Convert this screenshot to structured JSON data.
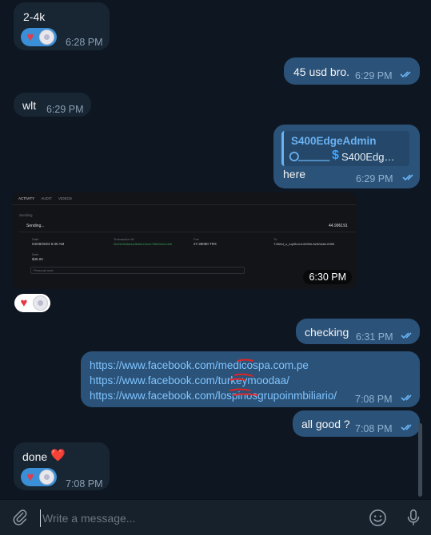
{
  "messages": {
    "m1": {
      "text": "2-4k",
      "time": "6:28 PM"
    },
    "m2": {
      "text": "45 usd bro.",
      "time": "6:29 PM"
    },
    "m3": {
      "text": "wlt",
      "time": "6:29 PM"
    },
    "m4": {
      "reply_name": "S400EdgeAdmin",
      "reply_text": "S400Edg…",
      "text": "here",
      "time": "6:29 PM"
    },
    "m5": {
      "time": "6:30 PM",
      "tabs": [
        "ACTIVITY",
        "AUDIT",
        "VIDEOS"
      ],
      "section": "Sending",
      "row_title": "Sending...",
      "row_amount": "44.996191",
      "date_label": "Date",
      "date_value": "04/28/2023 6:30 AM",
      "tx_label": "Transaction ID",
      "tx_value": "f3d2e05b8a4a3bd8ec1be475bf0d2e1d4b",
      "fee_label": "Fee",
      "fee_value": "27.39080 TRX",
      "to_label": "To",
      "to_value": "TJWhd_u_eq25cvUrUf09hL5eWhebIrrHi59",
      "note_label": "Note",
      "note_value": "$45.00",
      "note_placeholder": "Personal note"
    },
    "m6": {
      "text": "checking",
      "time": "6:31 PM"
    },
    "m7": {
      "links": [
        "https://www.facebook.com/medicospa.com.pe",
        "https://www.facebook.com/turkeymoodaa/",
        "https://www.facebook.com/lospinosgrupoinmbiliario/"
      ],
      "time": "7:08 PM"
    },
    "m8": {
      "text": "all good ?",
      "time": "7:08 PM"
    },
    "m9": {
      "text": "done",
      "emoji": "❤️",
      "time": "7:08 PM"
    }
  },
  "reactions": {
    "heart": "♥"
  },
  "composer": {
    "placeholder": "Write a message..."
  },
  "colors": {
    "accent": "#6ab2f2",
    "outgoing": "#2b5278",
    "incoming": "#182533",
    "background": "#0e1621"
  },
  "icons": [
    "paperclip-icon",
    "emoji-icon",
    "microphone-icon",
    "double-check-icon",
    "dollar-icon"
  ]
}
